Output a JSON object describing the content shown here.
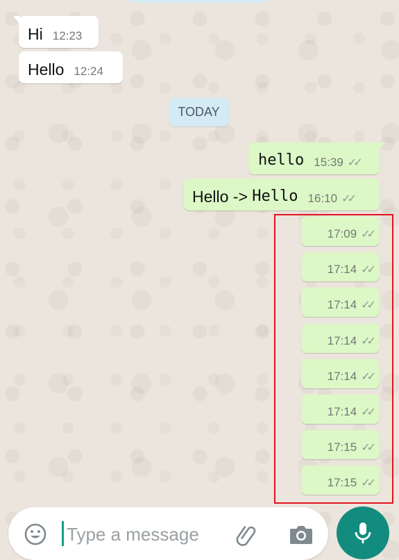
{
  "chat": {
    "date_chip": "TODAY",
    "incoming": [
      {
        "text": "Hi",
        "time": "12:23"
      },
      {
        "text": "Hello",
        "time": "12:24"
      }
    ],
    "outgoing": [
      {
        "text": "hello",
        "time": "15:39",
        "ticks": "✓✓"
      },
      {
        "text_pre": "Hello -> ",
        "text_mono": "Hello",
        "time": "16:10",
        "ticks": "✓✓"
      }
    ],
    "empty_outgoing": [
      {
        "time": "17:09",
        "ticks": "✓✓"
      },
      {
        "time": "17:14",
        "ticks": "✓✓"
      },
      {
        "time": "17:14",
        "ticks": "✓✓"
      },
      {
        "time": "17:14",
        "ticks": "✓✓"
      },
      {
        "time": "17:14",
        "ticks": "✓✓"
      },
      {
        "time": "17:14",
        "ticks": "✓✓"
      },
      {
        "time": "17:15",
        "ticks": "✓✓"
      },
      {
        "time": "17:15",
        "ticks": "✓✓"
      }
    ]
  },
  "composer": {
    "placeholder": "Type a message",
    "icons": [
      "emoji-icon",
      "paperclip-icon",
      "camera-icon",
      "microphone-icon"
    ]
  },
  "colors": {
    "incoming_bubble": "#ffffff",
    "outgoing_bubble": "#dcf8c6",
    "mic_button": "#128c7e",
    "highlight": "#e0141e",
    "date_chip": "#d4eaf4"
  }
}
